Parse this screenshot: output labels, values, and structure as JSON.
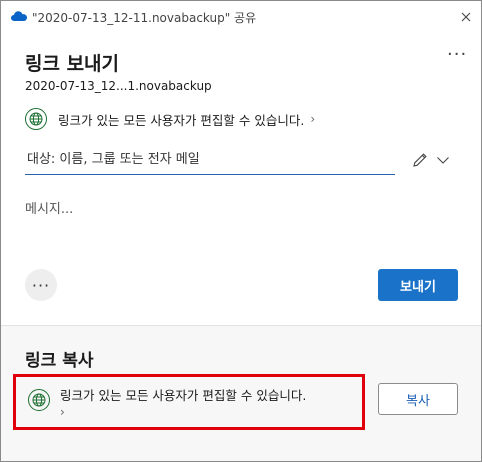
{
  "window": {
    "title": "\"2020-07-13_12-11.novabackup\" 공유"
  },
  "send": {
    "heading": "링크 보내기",
    "more_label": "···",
    "filename": "2020-07-13_12...1.novabackup",
    "permission_text": "링크가 있는 모든 사용자가 편집할 수 있습니다.",
    "permission_chevron": "›",
    "to_placeholder": "대상: 이름, 그룹 또는 전자 메일",
    "message_placeholder": "메시지...",
    "options_label": "···",
    "send_button": "보내기"
  },
  "copy": {
    "heading": "링크 복사",
    "permission_text": "링크가 있는 모든 사용자가 편집할 수 있습니다.",
    "permission_chevron": "›",
    "copy_button": "복사"
  },
  "colors": {
    "accent": "#1a73c9",
    "globe": "#1b6e2f",
    "highlight": "#e0000b",
    "onedrive": "#0a64c8"
  }
}
